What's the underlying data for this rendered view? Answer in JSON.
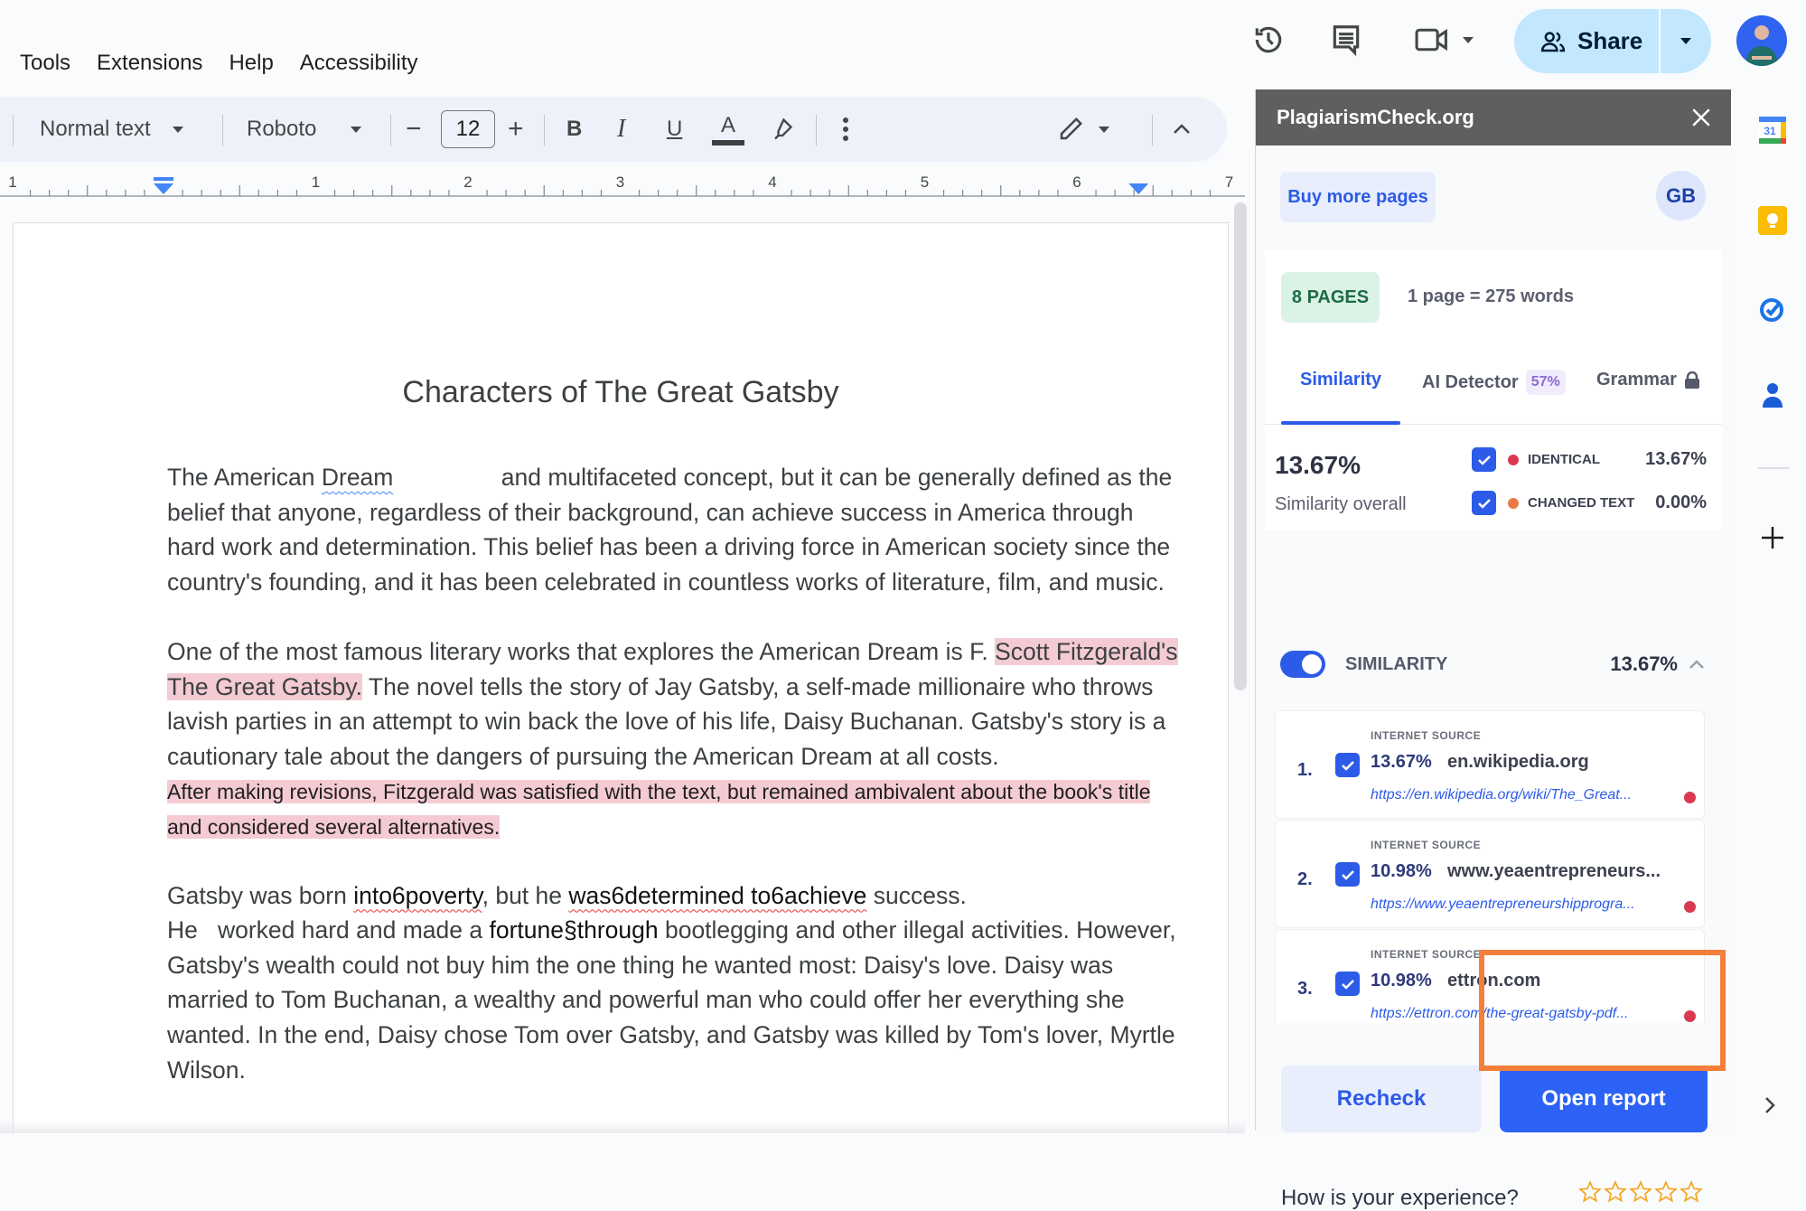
{
  "menu": [
    "Tools",
    "Extensions",
    "Help",
    "Accessibility"
  ],
  "header": {
    "share_label": "Share",
    "icons": [
      "version-history-icon",
      "comments-icon",
      "meet-icon",
      "share-people-icon",
      "avatar"
    ]
  },
  "toolbar": {
    "style": "Normal text",
    "font": "Roboto",
    "font_size": "12",
    "decrease": "−",
    "increase": "+",
    "bold": "B",
    "italic": "I",
    "underline": "U",
    "text_color": "A"
  },
  "ruler": {
    "labels": [
      "1",
      "1",
      "2",
      "3",
      "4",
      "5",
      "6",
      "7"
    ]
  },
  "document": {
    "title": "Characters of The Great Gatsby",
    "p1": {
      "a": "The American ",
      "squig": "Dream",
      "gap": "",
      "b": " and multifaceted concept, but it can be generally defined as the belief that anyone, regardless of their background, can achieve success in America through hard work and determination. This belief has been a driving force in American society since the country's founding, and it has been celebrated in countless works of literature, film, and music."
    },
    "p2": {
      "a": "One of the most famous literary works that explores the American Dream is F. ",
      "highlight": "Scott Fitzgerald's The Great Gatsby.",
      "b": " The novel tells the story of Jay Gatsby, a self-made millionaire who throws lavish parties in an attempt to win back the love of his life, Daisy Buchanan. Gatsby's story is a cautionary tale about the dangers of pursuing the American Dream at all costs."
    },
    "p3": "After making revisions, Fitzgerald was satisfied with the text, but remained ambivalent about the book's title and considered several alternatives.",
    "p4": {
      "a": "Gatsby was born ",
      "e1": "into6poverty",
      "b": ", but he ",
      "e2": "was6determined to6achieve",
      "c": " success.",
      "d": "He   worked hard and made a ",
      "e3": "fortune§through",
      "e": " bootlegging and other illegal  activities. However, Gatsby's wealth could not buy him the one thing he wanted most: Daisy's love. Daisy was married to Tom Buchanan, a wealthy and powerful man who could offer her everything she wanted. In the end, Daisy chose Tom over Gatsby, and Gatsby was killed by Tom's lover, Myrtle Wilson."
    }
  },
  "panel": {
    "title": "PlagiarismCheck.org",
    "buy_more": "Buy more pages",
    "user_initials": "GB",
    "pages_badge": "8 PAGES",
    "page_words": "1 page = 275 words",
    "tabs": [
      {
        "label": "Similarity",
        "active": true
      },
      {
        "label": "AI Detector",
        "badge": "57%"
      },
      {
        "label": "Grammar",
        "locked": true
      }
    ],
    "overall_pct": "13.67%",
    "overall_label": "Similarity overall",
    "legend": [
      {
        "label": "IDENTICAL",
        "value": "13.67%",
        "color": "#d93a52",
        "checked": true
      },
      {
        "label": "CHANGED TEXT",
        "value": "0.00%",
        "color": "#ea7a45",
        "checked": true
      }
    ],
    "similarity_toggle_label": "SIMILARITY",
    "similarity_toggle_on": true,
    "similarity_value": "13.67%",
    "sources": [
      {
        "num": "1.",
        "type": "INTERNET SOURCE",
        "pct": "13.67%",
        "domain": "en.wikipedia.org",
        "url": "https://en.wikipedia.org/wiki/The_Great...",
        "checked": true
      },
      {
        "num": "2.",
        "type": "INTERNET SOURCE",
        "pct": "10.98%",
        "domain": "www.yeaentrepreneurs...",
        "url": "https://www.yeaentrepreneurshipprogra...",
        "checked": true
      },
      {
        "num": "3.",
        "type": "INTERNET SOURCE",
        "pct": "10.98%",
        "domain": "ettron.com",
        "url": "https://ettron.com/the-great-gatsby-pdf...",
        "checked": true
      }
    ],
    "recheck": "Recheck",
    "open_report": "Open report",
    "feedback": "How is your experience?",
    "stars": 5,
    "rating": 0
  },
  "colors": {
    "accent": "#2c5be8",
    "highlight": "#f4cbd3",
    "panel_header": "#5f5f5f",
    "callout": "#f47f3b"
  }
}
